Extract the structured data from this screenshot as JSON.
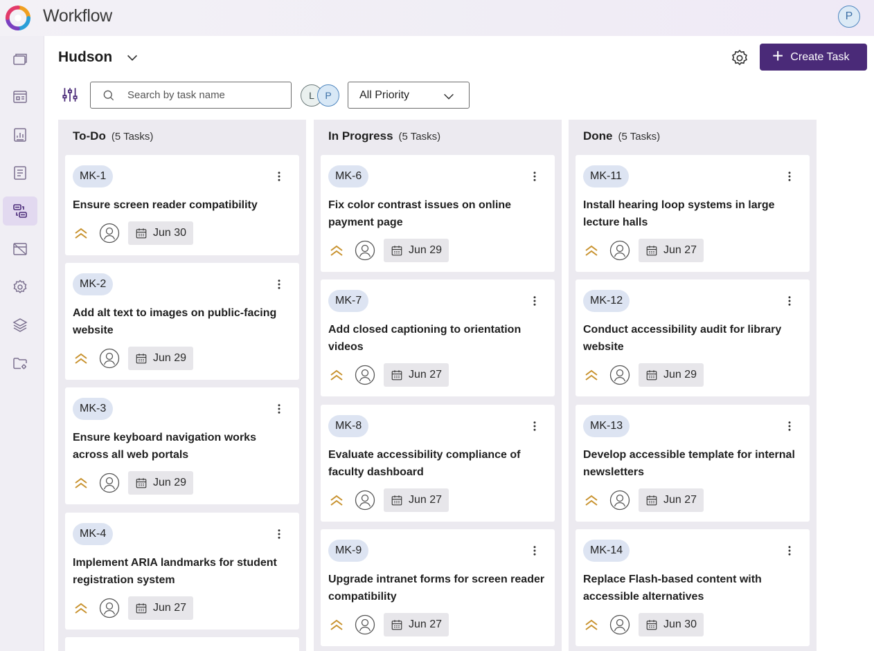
{
  "app": {
    "title": "Workflow",
    "user_initial": "P"
  },
  "sidebar": {
    "items": [
      {
        "name": "windows-icon"
      },
      {
        "name": "board-icon"
      },
      {
        "name": "report-icon"
      },
      {
        "name": "document-icon"
      },
      {
        "name": "workflow-icon",
        "active": true
      },
      {
        "name": "calendar-off-icon"
      },
      {
        "name": "settings-icon"
      },
      {
        "name": "layers-icon"
      },
      {
        "name": "folder-settings-icon"
      }
    ]
  },
  "header": {
    "project": "Hudson",
    "create_label": "Create Task"
  },
  "toolbar": {
    "search_placeholder": "Search by task name",
    "avatars": [
      "L",
      "P"
    ],
    "priority_value": "All Priority"
  },
  "columns": [
    {
      "title": "To-Do",
      "count": "(5 Tasks)",
      "cards": [
        {
          "id": "MK-1",
          "title": "Ensure screen reader compatibility",
          "due": "Jun 30"
        },
        {
          "id": "MK-2",
          "title": "Add alt text to images on public-facing website",
          "due": "Jun 29"
        },
        {
          "id": "MK-3",
          "title": "Ensure keyboard navigation works across all web portals",
          "due": "Jun 29"
        },
        {
          "id": "MK-4",
          "title": "Implement ARIA landmarks for student registration system",
          "due": "Jun 27"
        }
      ]
    },
    {
      "title": "In Progress",
      "count": "(5 Tasks)",
      "cards": [
        {
          "id": "MK-6",
          "title": "Fix color contrast issues on online payment page",
          "due": "Jun 29"
        },
        {
          "id": "MK-7",
          "title": "Add closed captioning to orientation videos",
          "due": "Jun 27"
        },
        {
          "id": "MK-8",
          "title": "Evaluate accessibility compliance of faculty dashboard",
          "due": "Jun 27"
        },
        {
          "id": "MK-9",
          "title": "Upgrade intranet forms for screen reader compatibility",
          "due": "Jun 27"
        }
      ]
    },
    {
      "title": "Done",
      "count": "(5 Tasks)",
      "cards": [
        {
          "id": "MK-11",
          "title": "Install hearing loop systems in large lecture halls",
          "due": "Jun 27"
        },
        {
          "id": "MK-12",
          "title": "Conduct accessibility audit for library website",
          "due": "Jun 29"
        },
        {
          "id": "MK-13",
          "title": "Develop accessible template for internal newsletters",
          "due": "Jun 27"
        },
        {
          "id": "MK-14",
          "title": "Replace Flash-based content with accessible alternatives",
          "due": "Jun 30"
        }
      ]
    }
  ],
  "colors": {
    "accent": "#4a2a78",
    "priority": "#c8922e",
    "column_bg": "#eceaf0",
    "tag_bg": "#dde4f2"
  }
}
